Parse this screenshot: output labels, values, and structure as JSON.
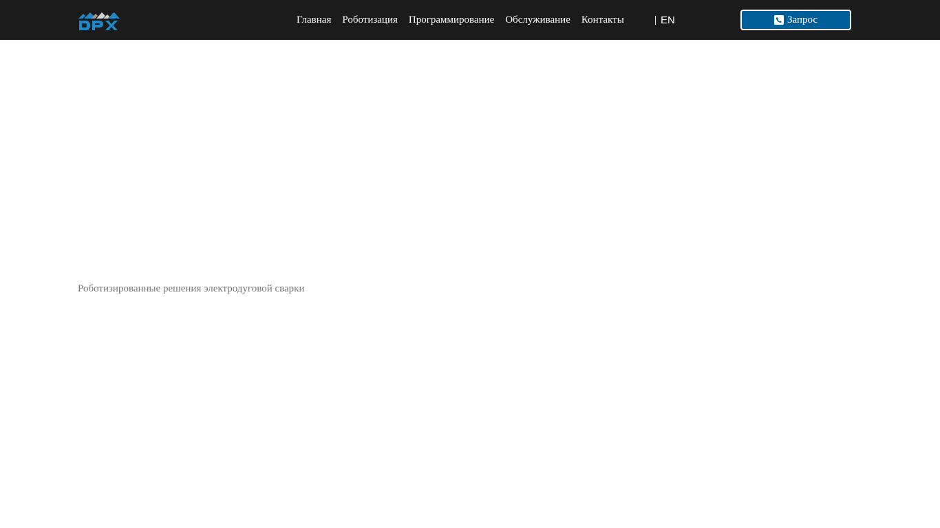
{
  "header": {
    "logo_text": "DPX",
    "nav": [
      {
        "label": "Главная"
      },
      {
        "label": "Роботизация"
      },
      {
        "label": "Программирование"
      },
      {
        "label": "Обслуживание"
      },
      {
        "label": "Контакты"
      }
    ],
    "language": "EN",
    "request_button": {
      "label": "Запрос",
      "icon": "phone-icon"
    }
  },
  "main": {
    "caption": "Роботизированные решения электродуговой сварки"
  },
  "colors": {
    "header_bg": "#1b1b1b",
    "accent_blue": "#005f99",
    "caption_text": "#777777"
  }
}
